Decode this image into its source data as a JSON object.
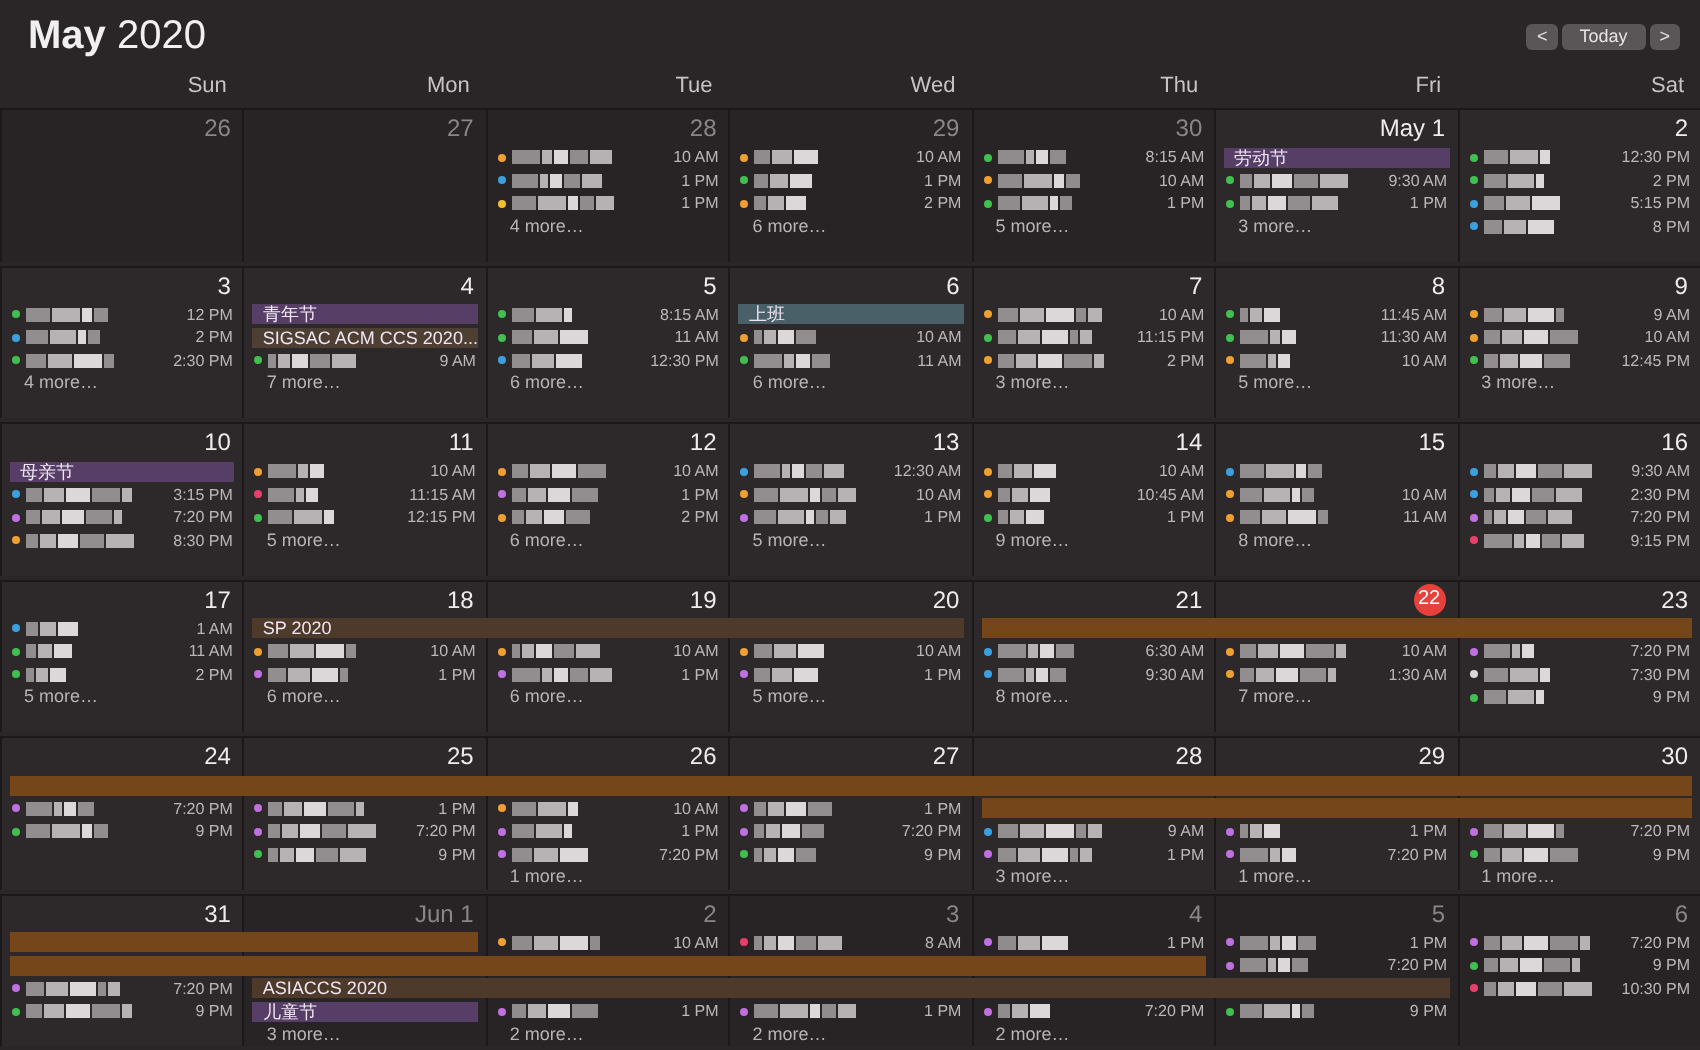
{
  "title": "**May** 2020",
  "nav": {
    "prev": "<",
    "today": "Today",
    "next": ">"
  },
  "weekdays": [
    "Sun",
    "Mon",
    "Tue",
    "Wed",
    "Thu",
    "Fri",
    "Sat"
  ],
  "weeks": [
    {
      "days": [
        {
          "number": "26",
          "other_month": true
        },
        {
          "number": "27",
          "other_month": true
        },
        {
          "number": "28",
          "other_month": true,
          "items": [
            {
              "kind": "event",
              "color": "#f0a030",
              "time": "10 AM"
            },
            {
              "kind": "event",
              "color": "#3aa0e0",
              "time": "1 PM"
            },
            {
              "kind": "event",
              "color": "#f0c030",
              "time": "1 PM"
            }
          ],
          "more": "4 more…"
        },
        {
          "number": "29",
          "other_month": true,
          "items": [
            {
              "kind": "event",
              "color": "#f0a030",
              "time": "10 AM"
            },
            {
              "kind": "event",
              "color": "#40c050",
              "time": "1 PM"
            },
            {
              "kind": "event",
              "color": "#f0a030",
              "time": "2 PM"
            }
          ],
          "more": "6 more…"
        },
        {
          "number": "30",
          "other_month": true,
          "items": [
            {
              "kind": "event",
              "color": "#40c050",
              "time": "8:15 AM"
            },
            {
              "kind": "event",
              "color": "#f0a030",
              "time": "10 AM"
            },
            {
              "kind": "event",
              "color": "#40c050",
              "time": "1 PM"
            }
          ],
          "more": "5 more…"
        },
        {
          "number": "May 1",
          "other_month": false,
          "items": [
            {
              "kind": "banner",
              "color": "#573e66",
              "label": "劳动节",
              "continued": false
            },
            {
              "kind": "event",
              "color": "#40c050",
              "time": "9:30 AM"
            },
            {
              "kind": "event",
              "color": "#40c050",
              "time": "1 PM"
            }
          ],
          "more": "3 more…"
        },
        {
          "number": "2",
          "other_month": false,
          "items": [
            {
              "kind": "event",
              "color": "#40c050",
              "time": "12:30 PM"
            },
            {
              "kind": "event",
              "color": "#40c050",
              "time": "2 PM"
            },
            {
              "kind": "event",
              "color": "#3aa0e0",
              "time": "5:15 PM"
            },
            {
              "kind": "event",
              "color": "#3aa0e0",
              "time": "8 PM"
            }
          ]
        }
      ]
    },
    {
      "days": [
        {
          "number": "3",
          "other_month": false,
          "items": [
            {
              "kind": "event",
              "color": "#40c050",
              "time": "12 PM"
            },
            {
              "kind": "event",
              "color": "#3aa0e0",
              "time": "2 PM"
            },
            {
              "kind": "event",
              "color": "#40c050",
              "time": "2:30 PM"
            }
          ],
          "more": "4 more…"
        },
        {
          "number": "4",
          "other_month": false,
          "items": [
            {
              "kind": "banner",
              "color": "#573e66",
              "label": "青年节",
              "continued": false
            },
            {
              "kind": "banner",
              "color": "#4d4033",
              "label": "SIGSAC ACM CCS 2020...",
              "continued": false
            },
            {
              "kind": "event",
              "color": "#40c050",
              "time": "9 AM"
            }
          ],
          "more": "7 more…"
        },
        {
          "number": "5",
          "other_month": false,
          "items": [
            {
              "kind": "event",
              "color": "#40c050",
              "time": "8:15 AM"
            },
            {
              "kind": "event",
              "color": "#40c050",
              "time": "11 AM"
            },
            {
              "kind": "event",
              "color": "#3aa0e0",
              "time": "12:30 PM"
            }
          ],
          "more": "6 more…"
        },
        {
          "number": "6",
          "other_month": false,
          "items": [
            {
              "kind": "banner",
              "color": "#4a6069",
              "label": "上班",
              "continued": false
            },
            {
              "kind": "event",
              "color": "#f0a030",
              "time": "10 AM"
            },
            {
              "kind": "event",
              "color": "#40c050",
              "time": "11 AM"
            }
          ],
          "more": "6 more…"
        },
        {
          "number": "7",
          "other_month": false,
          "items": [
            {
              "kind": "event",
              "color": "#f0a030",
              "time": "10 AM"
            },
            {
              "kind": "event",
              "color": "#40c050",
              "time": "11:15 PM"
            },
            {
              "kind": "event",
              "color": "#f0a030",
              "time": "2 PM"
            }
          ],
          "more": "3 more…"
        },
        {
          "number": "8",
          "other_month": false,
          "items": [
            {
              "kind": "event",
              "color": "#40c050",
              "time": "11:45 AM"
            },
            {
              "kind": "event",
              "color": "#40c050",
              "time": "11:30 AM"
            },
            {
              "kind": "event",
              "color": "#f0a030",
              "time": "10 AM"
            }
          ],
          "more": "5 more…"
        },
        {
          "number": "9",
          "other_month": false,
          "items": [
            {
              "kind": "event",
              "color": "#f0a030",
              "time": "9 AM"
            },
            {
              "kind": "event",
              "color": "#f0a030",
              "time": "10 AM"
            },
            {
              "kind": "event",
              "color": "#40c050",
              "time": "12:45 PM"
            }
          ],
          "more": "3 more…"
        }
      ]
    },
    {
      "days": [
        {
          "number": "10",
          "other_month": false,
          "items": [
            {
              "kind": "banner",
              "color": "#573e66",
              "label": "母亲节",
              "continued": false
            },
            {
              "kind": "event",
              "color": "#3aa0e0",
              "time": "3:15 PM"
            },
            {
              "kind": "event",
              "color": "#c070e0",
              "time": "7:20 PM"
            },
            {
              "kind": "event",
              "color": "#f0a030",
              "time": "8:30 PM"
            }
          ]
        },
        {
          "number": "11",
          "other_month": false,
          "items": [
            {
              "kind": "event",
              "color": "#f0a030",
              "time": "10 AM"
            },
            {
              "kind": "event",
              "color": "#e8406a",
              "time": "11:15 AM"
            },
            {
              "kind": "event",
              "color": "#40c050",
              "time": "12:15 PM"
            }
          ],
          "more": "5 more…"
        },
        {
          "number": "12",
          "other_month": false,
          "items": [
            {
              "kind": "event",
              "color": "#f0a030",
              "time": "10 AM"
            },
            {
              "kind": "event",
              "color": "#c070e0",
              "time": "1 PM"
            },
            {
              "kind": "event",
              "color": "#f0a030",
              "time": "2 PM"
            }
          ],
          "more": "6 more…"
        },
        {
          "number": "13",
          "other_month": false,
          "items": [
            {
              "kind": "event",
              "color": "#3aa0e0",
              "time": "12:30 AM"
            },
            {
              "kind": "event",
              "color": "#f0a030",
              "time": "10 AM"
            },
            {
              "kind": "event",
              "color": "#c070e0",
              "time": "1 PM"
            }
          ],
          "more": "5 more…"
        },
        {
          "number": "14",
          "other_month": false,
          "items": [
            {
              "kind": "event",
              "color": "#f0a030",
              "time": "10 AM"
            },
            {
              "kind": "event",
              "color": "#f0a030",
              "time": "10:45 AM"
            },
            {
              "kind": "event",
              "color": "#40c050",
              "time": "1 PM"
            }
          ],
          "more": "9 more…"
        },
        {
          "number": "15",
          "other_month": false,
          "items": [
            {
              "kind": "event",
              "color": "#3aa0e0"
            },
            {
              "kind": "event",
              "color": "#f0a030",
              "time": "10 AM"
            },
            {
              "kind": "event",
              "color": "#f0a030",
              "time": "11 AM"
            }
          ],
          "more": "8 more…"
        },
        {
          "number": "16",
          "other_month": false,
          "items": [
            {
              "kind": "event",
              "color": "#3aa0e0",
              "time": "9:30 AM"
            },
            {
              "kind": "event",
              "color": "#3aa0e0",
              "time": "2:30 PM"
            },
            {
              "kind": "event",
              "color": "#c070e0",
              "time": "7:20 PM"
            },
            {
              "kind": "event",
              "color": "#e8406a",
              "time": "9:15 PM"
            }
          ]
        }
      ]
    },
    {
      "days": [
        {
          "number": "17",
          "other_month": false,
          "items": [
            {
              "kind": "event",
              "color": "#3aa0e0",
              "time": "1 AM"
            },
            {
              "kind": "event",
              "color": "#40c050",
              "time": "11 AM"
            },
            {
              "kind": "event",
              "color": "#40c050",
              "time": "2 PM"
            }
          ],
          "more": "5 more…"
        },
        {
          "number": "18",
          "other_month": false,
          "items": [
            {
              "kind": "banner",
              "color": "#4d3a2a",
              "label": "SP 2020",
              "continued": false
            },
            {
              "kind": "event",
              "color": "#f0a030",
              "time": "10 AM"
            },
            {
              "kind": "event",
              "color": "#c070e0",
              "time": "1 PM"
            }
          ],
          "more": "6 more…"
        },
        {
          "number": "19",
          "other_month": false,
          "items": [
            {
              "kind": "banner",
              "color": "#4d3a2a",
              "continued": true
            },
            {
              "kind": "event",
              "color": "#f0a030",
              "time": "10 AM"
            },
            {
              "kind": "event",
              "color": "#c070e0",
              "time": "1 PM"
            }
          ],
          "more": "6 more…"
        },
        {
          "number": "20",
          "other_month": false,
          "items": [
            {
              "kind": "banner",
              "color": "#4d3a2a",
              "continued": true
            },
            {
              "kind": "event",
              "color": "#f0a030",
              "time": "10 AM"
            },
            {
              "kind": "event",
              "color": "#c070e0",
              "time": "1 PM"
            }
          ],
          "more": "5 more…"
        },
        {
          "number": "21",
          "other_month": false,
          "items": [
            {
              "kind": "banner",
              "color": "#74461a",
              "continued": false
            },
            {
              "kind": "event",
              "color": "#3aa0e0",
              "time": "6:30 AM"
            },
            {
              "kind": "event",
              "color": "#3aa0e0",
              "time": "9:30 AM"
            }
          ],
          "more": "8 more…"
        },
        {
          "number": "22",
          "other_month": false,
          "today": true,
          "items": [
            {
              "kind": "banner",
              "color": "#74461a",
              "continued": true
            },
            {
              "kind": "event",
              "color": "#f0a030",
              "time": "10 AM"
            },
            {
              "kind": "event",
              "color": "#f0a030",
              "time": "1:30 AM"
            }
          ],
          "more": "7 more…"
        },
        {
          "number": "23",
          "other_month": false,
          "items": [
            {
              "kind": "banner",
              "color": "#74461a",
              "continued": true
            },
            {
              "kind": "event",
              "color": "#c070e0",
              "time": "7:20 PM"
            },
            {
              "kind": "event",
              "color": "#d8d8d8",
              "time": "7:30 PM"
            },
            {
              "kind": "event",
              "color": "#40c050",
              "time": "9 PM"
            }
          ]
        }
      ]
    },
    {
      "days": [
        {
          "number": "24",
          "other_month": false,
          "items": [
            {
              "kind": "banner",
              "color": "#74461a",
              "continued": false
            },
            {
              "kind": "event",
              "color": "#c070e0",
              "time": "7:20 PM"
            },
            {
              "kind": "event",
              "color": "#40c050",
              "time": "9 PM"
            }
          ]
        },
        {
          "number": "25",
          "other_month": false,
          "items": [
            {
              "kind": "banner",
              "color": "#74461a",
              "continued": true
            },
            {
              "kind": "event",
              "color": "#c070e0",
              "time": "1 PM"
            },
            {
              "kind": "event",
              "color": "#c070e0",
              "time": "7:20 PM"
            },
            {
              "kind": "event",
              "color": "#40c050",
              "time": "9 PM"
            }
          ]
        },
        {
          "number": "26",
          "other_month": false,
          "items": [
            {
              "kind": "banner",
              "color": "#74461a",
              "continued": true
            },
            {
              "kind": "event",
              "color": "#f0a030",
              "time": "10 AM"
            },
            {
              "kind": "event",
              "color": "#c070e0",
              "time": "1 PM"
            },
            {
              "kind": "event",
              "color": "#c070e0",
              "time": "7:20 PM"
            }
          ],
          "more": "1 more…"
        },
        {
          "number": "27",
          "other_month": false,
          "items": [
            {
              "kind": "banner",
              "color": "#74461a",
              "continued": true
            },
            {
              "kind": "event",
              "color": "#c070e0",
              "time": "1 PM"
            },
            {
              "kind": "event",
              "color": "#c070e0",
              "time": "7:20 PM"
            },
            {
              "kind": "event",
              "color": "#40c050",
              "time": "9 PM"
            }
          ]
        },
        {
          "number": "28",
          "other_month": false,
          "items": [
            {
              "kind": "banner",
              "color": "#74461a",
              "continued": true
            },
            {
              "kind": "banner",
              "color": "#74461a",
              "continued": false
            },
            {
              "kind": "event",
              "color": "#3aa0e0",
              "time": "9 AM"
            },
            {
              "kind": "event",
              "color": "#c070e0",
              "time": "1 PM"
            }
          ],
          "more": "3 more…"
        },
        {
          "number": "29",
          "other_month": false,
          "items": [
            {
              "kind": "banner",
              "color": "#74461a",
              "continued": true
            },
            {
              "kind": "banner",
              "color": "#74461a",
              "continued": true
            },
            {
              "kind": "event",
              "color": "#c070e0",
              "time": "1 PM"
            },
            {
              "kind": "event",
              "color": "#c070e0",
              "time": "7:20 PM"
            }
          ],
          "more": "1 more…"
        },
        {
          "number": "30",
          "other_month": false,
          "items": [
            {
              "kind": "banner",
              "color": "#74461a",
              "continued": true
            },
            {
              "kind": "banner",
              "color": "#74461a",
              "continued": true
            },
            {
              "kind": "event",
              "color": "#c070e0",
              "time": "7:20 PM"
            },
            {
              "kind": "event",
              "color": "#40c050",
              "time": "9 PM"
            }
          ],
          "more": "1 more…"
        }
      ]
    },
    {
      "days": [
        {
          "number": "31",
          "other_month": false,
          "items": [
            {
              "kind": "banner",
              "color": "#74461a",
              "continued": false
            },
            {
              "kind": "banner",
              "color": "#74461a",
              "continued": false
            },
            {
              "kind": "event",
              "color": "#c070e0",
              "time": "7:20 PM"
            },
            {
              "kind": "event",
              "color": "#40c050",
              "time": "9 PM"
            }
          ]
        },
        {
          "number": "Jun 1",
          "other_month": true,
          "items": [
            {
              "kind": "banner",
              "color": "#74461a",
              "continued": true
            },
            {
              "kind": "banner",
              "color": "#74461a",
              "continued": true
            },
            {
              "kind": "banner",
              "color": "#4d3a2a",
              "label": "ASIACCS 2020",
              "continued": false
            },
            {
              "kind": "banner",
              "color": "#573e66",
              "label": "儿童节",
              "continued": false
            }
          ],
          "more": "3 more…"
        },
        {
          "number": "2",
          "other_month": true,
          "items": [
            {
              "kind": "event",
              "color": "#f0a030",
              "time": "10 AM"
            },
            {
              "kind": "banner",
              "color": "#74461a",
              "continued": true
            },
            {
              "kind": "banner",
              "color": "#4d3a2a",
              "continued": true
            },
            {
              "kind": "event",
              "color": "#c070e0",
              "time": "1 PM"
            }
          ],
          "more": "2 more…"
        },
        {
          "number": "3",
          "other_month": true,
          "items": [
            {
              "kind": "event",
              "color": "#e8406a",
              "time": "8 AM"
            },
            {
              "kind": "banner",
              "color": "#74461a",
              "continued": true
            },
            {
              "kind": "banner",
              "color": "#4d3a2a",
              "continued": true
            },
            {
              "kind": "event",
              "color": "#c070e0",
              "time": "1 PM"
            }
          ],
          "more": "2 more…"
        },
        {
          "number": "4",
          "other_month": true,
          "items": [
            {
              "kind": "event",
              "color": "#c070e0",
              "time": "1 PM"
            },
            {
              "kind": "banner",
              "color": "#74461a",
              "continued": true
            },
            {
              "kind": "banner",
              "color": "#4d3a2a",
              "continued": true
            },
            {
              "kind": "event",
              "color": "#c070e0",
              "time": "7:20 PM"
            }
          ],
          "more": "2 more…"
        },
        {
          "number": "5",
          "other_month": true,
          "items": [
            {
              "kind": "event",
              "color": "#c070e0",
              "time": "1 PM"
            },
            {
              "kind": "event",
              "color": "#c070e0",
              "time": "7:20 PM"
            },
            {
              "kind": "banner",
              "color": "#4d3a2a",
              "continued": true
            },
            {
              "kind": "event",
              "color": "#40c050",
              "time": "9 PM"
            }
          ]
        },
        {
          "number": "6",
          "other_month": true,
          "items": [
            {
              "kind": "event",
              "color": "#c070e0",
              "time": "7:20 PM"
            },
            {
              "kind": "event",
              "color": "#40c050",
              "time": "9 PM"
            },
            {
              "kind": "event",
              "color": "#e8406a",
              "time": "10:30 PM"
            }
          ]
        }
      ]
    }
  ]
}
